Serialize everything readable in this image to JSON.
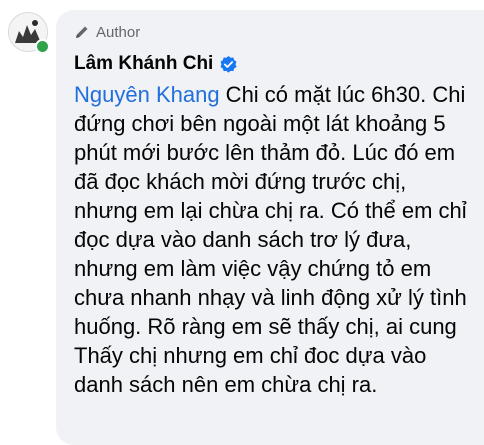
{
  "comment": {
    "badge": {
      "label": "Author",
      "icon": "pen-icon"
    },
    "author": {
      "name": "Lâm Khánh Chi",
      "verified_icon": "verified-badge-icon",
      "online": true
    },
    "mention": "Nguyên Khang",
    "text": " Chi có mặt lúc 6h30. Chi đứng chơi bên ngoài một lát khoảng 5 phút mới bước lên thảm đỏ. Lúc đó em đã đọc khách mời đứng trước chị, nhưng em lại chừa chị ra. Có thể em chỉ đọc dựa vào danh sách trơ lý đưa, nhưng em làm việc vậy chứng tỏ em chưa nhanh nhạy và linh động xử lý tình huống. Rõ ràng em sẽ thấy chị, ai cung Thấy chị nhưng em chỉ đoc dựa vào danh sách nên em chừa chị ra."
  },
  "colors": {
    "bubble_bg": "#f0f2f5",
    "mention": "#216fdb",
    "verified": "#1877f2",
    "online": "#31a24c",
    "muted_text": "#65676b"
  }
}
